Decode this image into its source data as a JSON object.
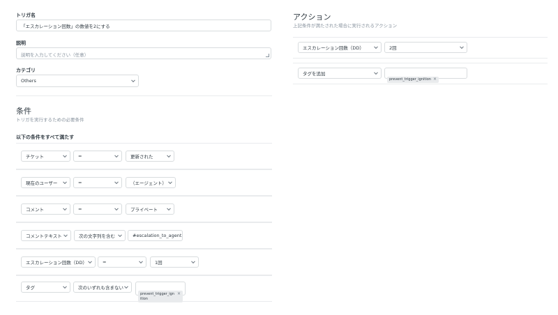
{
  "trigger": {
    "name_label": "トリガ名",
    "name_value": "「エスカレーション回数」の数値を2にする",
    "desc_label": "説明",
    "desc_placeholder": "説明を入力してください（任意）",
    "category_label": "カテゴリ",
    "category_value": "Others"
  },
  "conditions": {
    "title": "条件",
    "subtitle": "トリガを実行するための必要条件",
    "all_label": "以下の条件をすべて満たす",
    "rows": [
      {
        "field": "チケット",
        "op": "=",
        "value": "更新された"
      },
      {
        "field": "現在のユーザー",
        "op": "=",
        "value": "（エージェント）"
      },
      {
        "field": "コメント",
        "op": "=",
        "value": "プライベート"
      },
      {
        "field": "コメントテキスト",
        "op": "次の文字列を含む",
        "value": "#escalation_to_agent"
      },
      {
        "field": "エスカレーション回数（DD）",
        "op": "=",
        "value": "1回"
      },
      {
        "field": "タグ",
        "op": "次のいずれも含まない",
        "value": "prevent_trigger_ignition"
      }
    ]
  },
  "actions": {
    "title": "アクション",
    "subtitle": "上記条件が満たされた場合に実行されるアクション",
    "rows": [
      {
        "field": "エスカレーション回数（DD）",
        "value": "2回"
      },
      {
        "field": "タグを追加",
        "value": "prevent_trigger_ignition"
      }
    ]
  },
  "icons": {
    "tag_remove": "×"
  }
}
